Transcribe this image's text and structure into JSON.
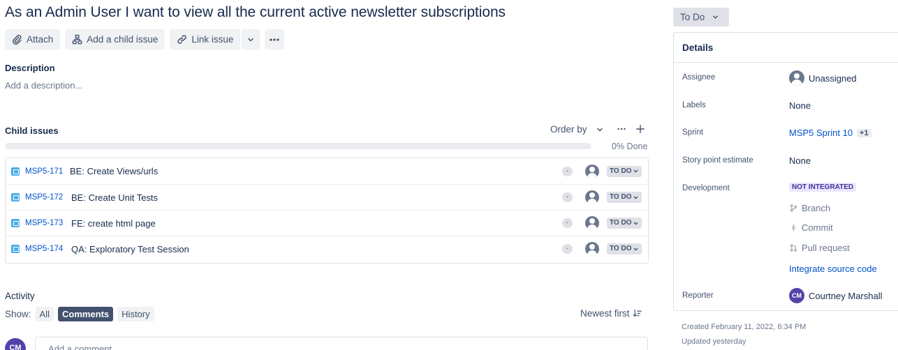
{
  "issue": {
    "title": "As an Admin User I want to view all the current active newsletter subscriptions"
  },
  "toolbar": {
    "attach_label": "Attach",
    "add_child_label": "Add a child issue",
    "link_issue_label": "Link issue"
  },
  "description": {
    "heading": "Description",
    "placeholder": "Add a description..."
  },
  "child_issues": {
    "heading": "Child issues",
    "order_by_label": "Order by",
    "progress_label": "0% Done",
    "progress_fraction": 0,
    "items": [
      {
        "key": "MSP5-171",
        "summary": "BE: Create Views/urls",
        "points": "-",
        "status": "TO DO"
      },
      {
        "key": "MSP5-172",
        "summary": "BE: Create Unit Tests",
        "points": "-",
        "status": "TO DO"
      },
      {
        "key": "MSP5-173",
        "summary": "FE: create html page",
        "points": "-",
        "status": "TO DO"
      },
      {
        "key": "MSP5-174",
        "summary": "QA: Exploratory Test Session",
        "points": "-",
        "status": "TO DO"
      }
    ]
  },
  "activity": {
    "heading": "Activity",
    "show_label": "Show:",
    "filters": [
      "All",
      "Comments",
      "History"
    ],
    "active_filter": "Comments",
    "sort_label": "Newest first",
    "comment_placeholder": "Add a comment...",
    "user_initials": "CM"
  },
  "status_button": {
    "label": "To Do"
  },
  "details": {
    "heading": "Details",
    "assignee_label": "Assignee",
    "assignee_value": "Unassigned",
    "labels_label": "Labels",
    "labels_value": "None",
    "sprint_label": "Sprint",
    "sprint_value": "MSP5 Sprint 10",
    "sprint_extra": "+1",
    "story_points_label": "Story point estimate",
    "story_points_value": "None",
    "development_label": "Development",
    "development_badge": "NOT INTEGRATED",
    "branch_label": "Branch",
    "commit_label": "Commit",
    "pull_request_label": "Pull request",
    "integrate_link": "Integrate source code",
    "reporter_label": "Reporter",
    "reporter_initials": "CM",
    "reporter_value": "Courtney Marshall"
  },
  "meta": {
    "created": "Created February 11, 2022, 6:34 PM",
    "updated": "Updated yesterday"
  },
  "colors": {
    "link": "#0052cc",
    "story_icon": "#4bade8",
    "avatar_purple": "#5243aa",
    "not_integrated_bg": "#eae6ff"
  }
}
